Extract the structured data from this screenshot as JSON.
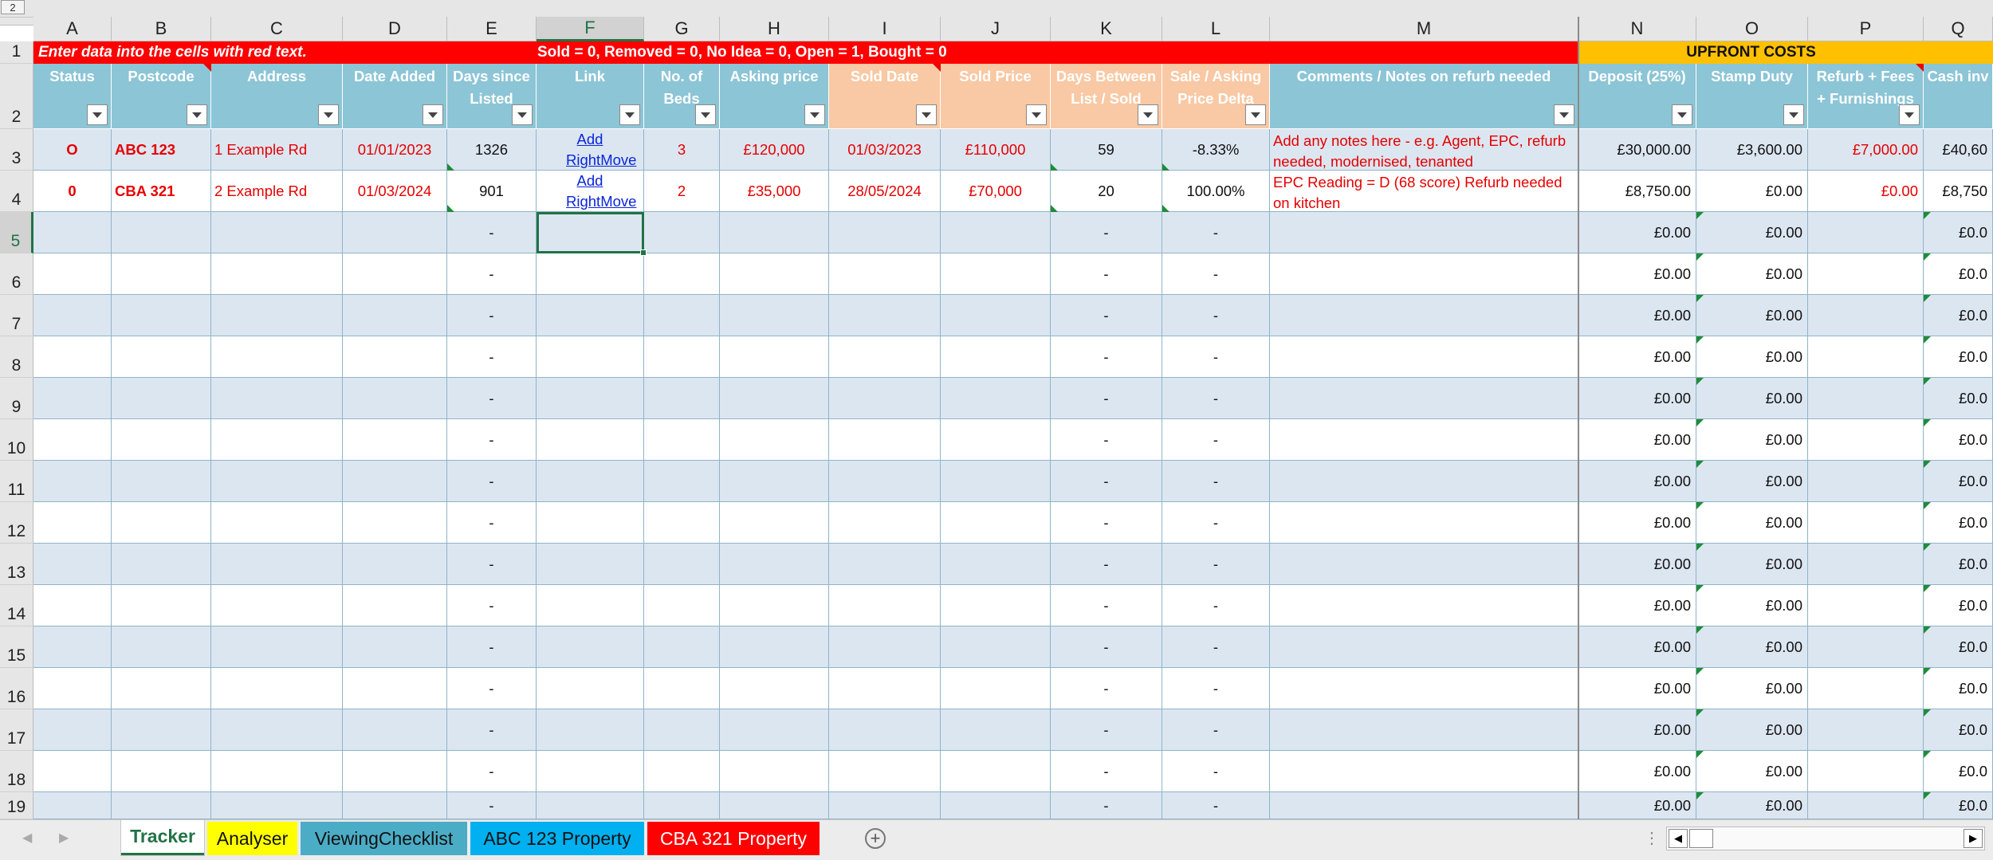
{
  "row_one": {
    "instruction": "Enter data into the cells with red text.",
    "status_key": "Sold = 0, Removed = 0, No Idea = 0, Open  = 1, Bought  = 0",
    "upfront_costs": "UPFRONT COSTS"
  },
  "column_letters": [
    "A",
    "B",
    "C",
    "D",
    "E",
    "F",
    "G",
    "H",
    "I",
    "J",
    "K",
    "L",
    "M",
    "N",
    "O",
    "P",
    "Q"
  ],
  "row_numbers": [
    "1",
    "2",
    "3",
    "4",
    "5",
    "6",
    "7",
    "8",
    "9",
    "10",
    "11",
    "12",
    "13",
    "14",
    "15",
    "16",
    "17",
    "18",
    "19"
  ],
  "corner_label": "2",
  "headers": [
    "Status",
    "Postcode",
    "Address",
    "Date Added",
    "Days since Listed",
    "Link",
    "No. of Beds",
    "Asking price",
    "Sold Date",
    "Sold Price",
    "Days Between List / Sold",
    "Sale / Asking Price Delta",
    "Comments / Notes on refurb needed",
    "Deposit (25%)",
    "Stamp Duty",
    "Refurb + Fees + Furnishings",
    "Cash inv"
  ],
  "rows": [
    {
      "status": "O",
      "postcode": "ABC 123",
      "address": "1 Example Rd",
      "date_added": "01/01/2023",
      "days_listed": "1326",
      "link": "Add RightMove",
      "beds": "3",
      "asking": "£120,000",
      "sold_date": "01/03/2023",
      "sold_price": "£110,000",
      "days_between": "59",
      "delta": "-8.33%",
      "comments": "Add any notes here - e.g. Agent, EPC, refurb needed, modernised, tenanted",
      "deposit": "£30,000.00",
      "stamp": "£3,600.00",
      "refurb": "£7,000.00",
      "cash": "£40,60"
    },
    {
      "status": "0",
      "postcode": "CBA 321",
      "address": "2 Example Rd",
      "date_added": "01/03/2024",
      "days_listed": "901",
      "link": "Add RightMove",
      "beds": "2",
      "asking": "£35,000",
      "sold_date": "28/05/2024",
      "sold_price": "£70,000",
      "days_between": "20",
      "delta": "100.00%",
      "comments": "EPC Reading = D (68 score) Refurb needed on kitchen",
      "deposit": "£8,750.00",
      "stamp": "£0.00",
      "refurb": "£0.00",
      "cash": "£8,750"
    }
  ],
  "empty_row_values": {
    "dash": "-",
    "money": "£0.00",
    "cash": "£0.0"
  },
  "sheet_tabs": [
    {
      "label": "Tracker",
      "color": "#ffffff",
      "text": "#217346",
      "active": true
    },
    {
      "label": "Analyser",
      "color": "#ffff00",
      "text": "#111111",
      "active": false
    },
    {
      "label": "ViewingChecklist",
      "color": "#4bacc6",
      "text": "#111111",
      "active": false
    },
    {
      "label": "ABC 123 Property",
      "color": "#00b0f0",
      "text": "#111111",
      "active": false
    },
    {
      "label": "CBA 321 Property",
      "color": "#ff0000",
      "text": "#ffffff",
      "active": false
    }
  ],
  "colors": {
    "header_teal": "#8cc5d6",
    "header_peach": "#f8c9a4",
    "banner_red": "#ff0000",
    "banner_orange": "#ffc000",
    "band_blue": "#dce6f1",
    "accent_green": "#217346"
  }
}
